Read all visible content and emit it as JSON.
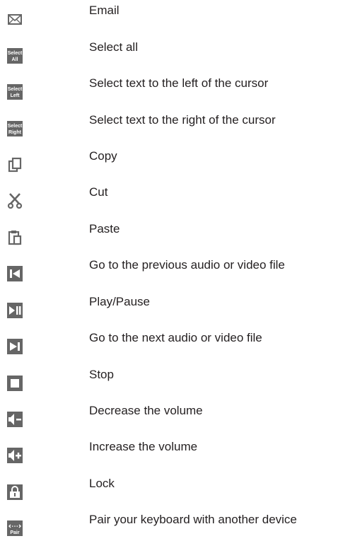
{
  "items": [
    {
      "icon": "email-icon",
      "label": "Email"
    },
    {
      "icon": "select-all-icon",
      "label": "Select all",
      "icon_text": [
        "Select",
        "All"
      ]
    },
    {
      "icon": "select-left-icon",
      "label": "Select text to the left of the cursor",
      "icon_text": [
        "Select",
        "Left"
      ]
    },
    {
      "icon": "select-right-icon",
      "label": "Select text to the right of the cursor",
      "icon_text": [
        "Select",
        "Right"
      ]
    },
    {
      "icon": "copy-icon",
      "label": "Copy"
    },
    {
      "icon": "cut-icon",
      "label": "Cut"
    },
    {
      "icon": "paste-icon",
      "label": "Paste"
    },
    {
      "icon": "previous-track-icon",
      "label": "Go to the previous audio or video file"
    },
    {
      "icon": "play-pause-icon",
      "label": "Play/Pause"
    },
    {
      "icon": "next-track-icon",
      "label": "Go to the next audio or video file"
    },
    {
      "icon": "stop-icon",
      "label": "Stop"
    },
    {
      "icon": "volume-down-icon",
      "label": "Decrease the volume"
    },
    {
      "icon": "volume-up-icon",
      "label": "Increase the volume"
    },
    {
      "icon": "lock-icon",
      "label": "Lock"
    },
    {
      "icon": "pair-icon",
      "label": "Pair your keyboard with another device",
      "icon_text": [
        "Pair"
      ]
    }
  ],
  "colors": {
    "icon_gray": "#666666",
    "icon_light": "#ffffff",
    "text": "#231f20"
  }
}
